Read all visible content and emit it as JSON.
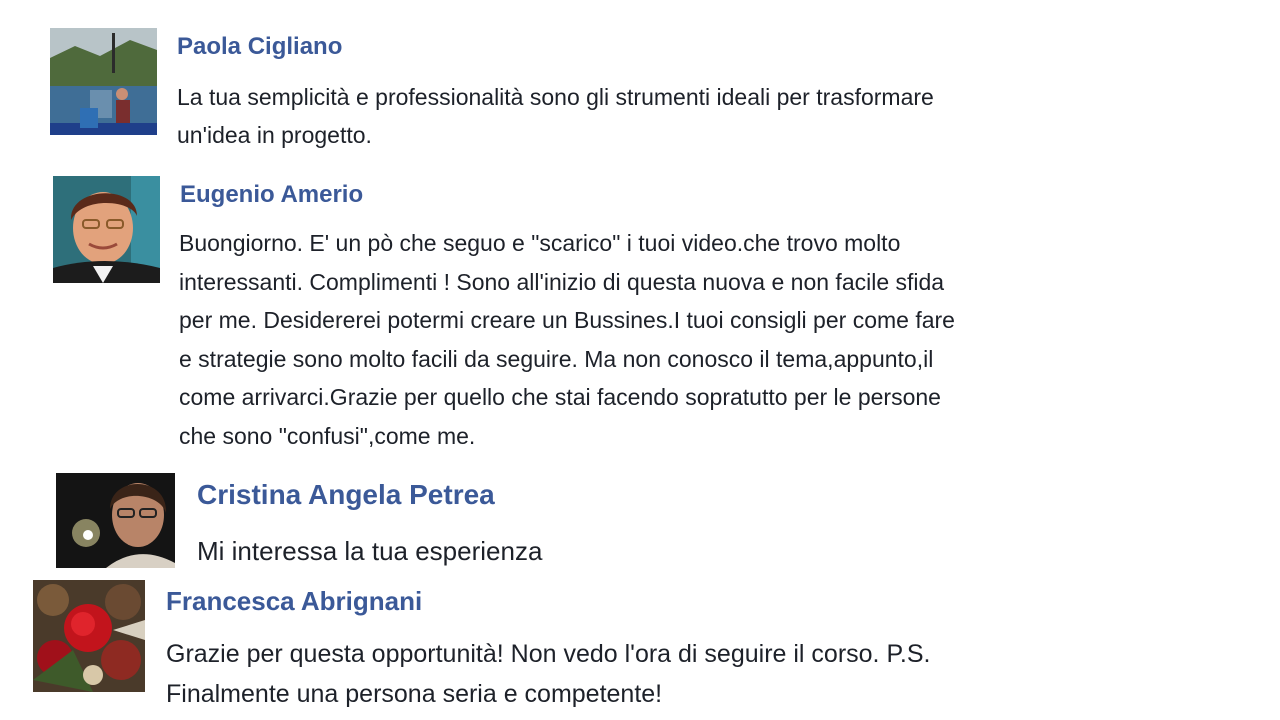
{
  "comments": [
    {
      "name": "Paola Cigliano",
      "avatar_icon": "user-photo-lake-icon",
      "lines": [
        "La tua semplicità e professionalità sono gli strumenti ideali per trasformare",
        "un'idea in progetto."
      ]
    },
    {
      "name": "Eugenio Amerio",
      "avatar_icon": "user-photo-portrait-icon",
      "lines": [
        "Buongiorno. E' un pò che seguo e \"scarico\" i tuoi video.che trovo molto",
        "interessanti. Complimenti ! Sono all'inizio di questa nuova e non facile sfida",
        "per me. Desidererei potermi creare un Bussines.I tuoi consigli per come fare",
        "e strategie sono molto facili da seguire. Ma non conosco il tema,appunto,il",
        "come arrivarci.Grazie per quello che stai facendo sopratutto per le persone",
        "che sono \"confusi\",come me."
      ]
    },
    {
      "name": "Cristina Angela Petrea",
      "avatar_icon": "user-photo-dark-portrait-icon",
      "lines": [
        "Mi interessa la tua esperienza"
      ]
    },
    {
      "name": "Francesca Abrignani",
      "avatar_icon": "user-photo-roses-icon",
      "lines": [
        "Grazie per questa opportunità! Non vedo l'ora di seguire il corso. P.S.",
        "Finalmente una persona seria e competente!"
      ]
    }
  ]
}
